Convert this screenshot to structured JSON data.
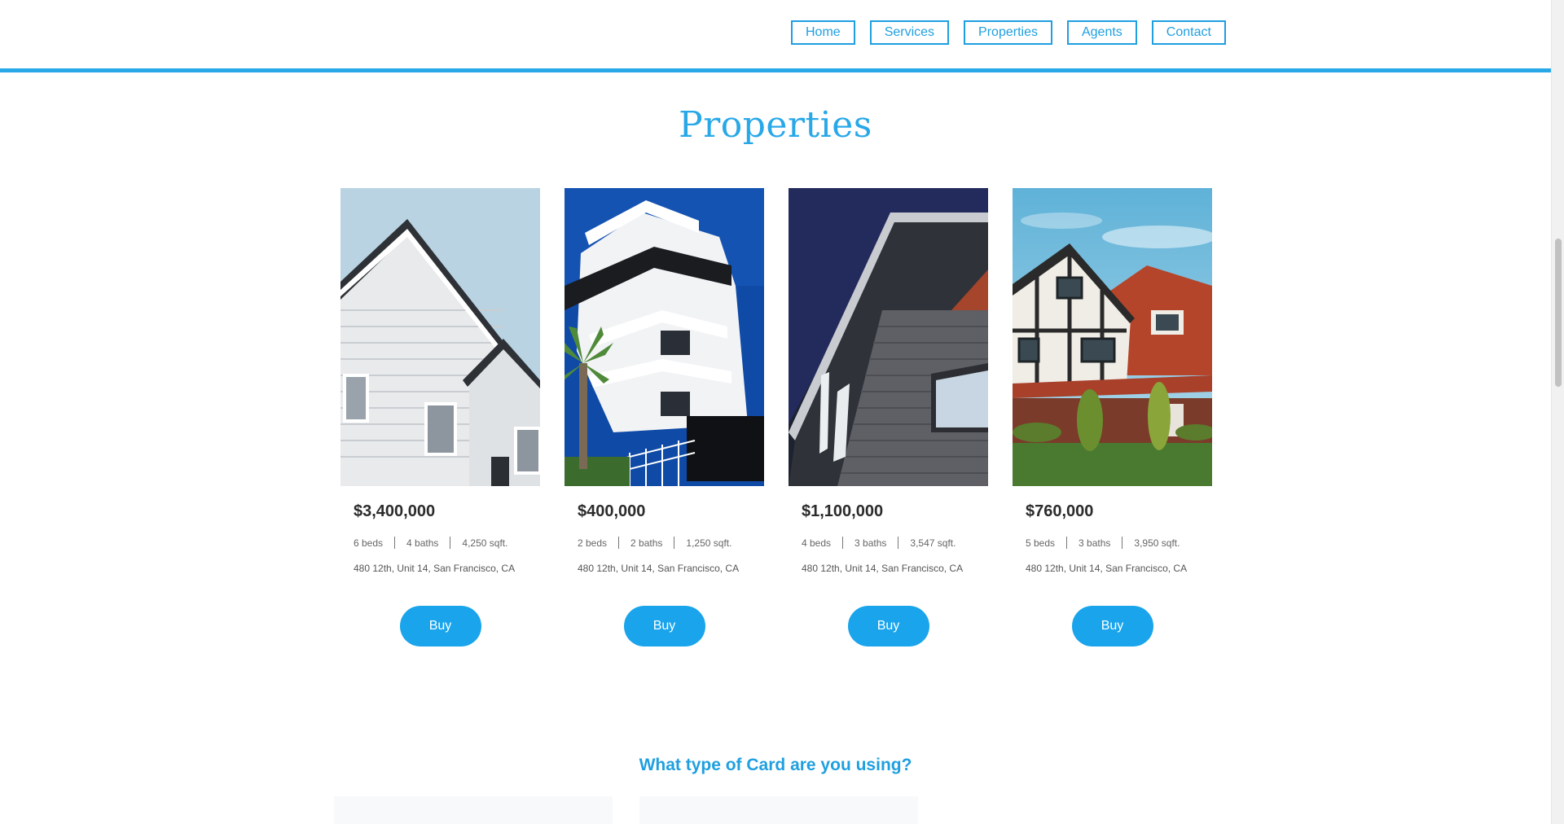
{
  "nav": {
    "items": [
      {
        "label": "Home"
      },
      {
        "label": "Services"
      },
      {
        "label": "Properties"
      },
      {
        "label": "Agents"
      },
      {
        "label": "Contact"
      }
    ]
  },
  "colors": {
    "accent": "#29a8e8",
    "button": "#19a4ec",
    "text_dark": "#2b2b2b"
  },
  "properties": {
    "title": "Properties",
    "cards": [
      {
        "price": "$3,400,000",
        "beds": "6 beds",
        "baths": "4 baths",
        "sqft": "4,250 sqft.",
        "address": "480 12th, Unit 14, San Francisco, CA",
        "button": "Buy",
        "image": "white-gabled-house-photo"
      },
      {
        "price": "$400,000",
        "beds": "2 beds",
        "baths": "2 baths",
        "sqft": "1,250 sqft.",
        "address": "480 12th, Unit 14, San Francisco, CA",
        "button": "Buy",
        "image": "modern-white-apartment-photo"
      },
      {
        "price": "$1,100,000",
        "beds": "4 beds",
        "baths": "3 baths",
        "sqft": "3,547 sqft.",
        "address": "480 12th, Unit 14, San Francisco, CA",
        "button": "Buy",
        "image": "brick-building-corner-photo"
      },
      {
        "price": "$760,000",
        "beds": "5 beds",
        "baths": "3 baths",
        "sqft": "3,950 sqft.",
        "address": "480 12th, Unit 14, San Francisco, CA",
        "button": "Buy",
        "image": "tudor-style-house-photo"
      }
    ]
  },
  "cards_section": {
    "title": "What type of Card are you using?"
  }
}
